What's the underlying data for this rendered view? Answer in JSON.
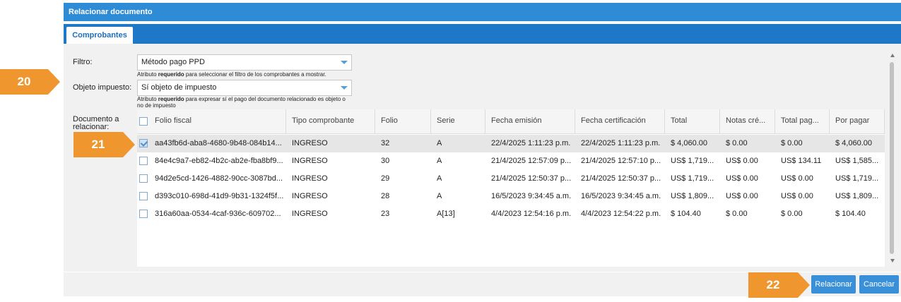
{
  "dialog": {
    "title": "Relacionar documento",
    "tab_label": "Comprobantes"
  },
  "form": {
    "filter_label": "Filtro:",
    "filter_value": "Método pago PPD",
    "filter_hint_pre": "Atributo ",
    "filter_hint_bold": "requerido",
    "filter_hint_post": " para seleccionar el filtro de los comprobantes a mostrar.",
    "tax_label": "Objeto impuesto:",
    "tax_value": "Sí objeto de impuesto",
    "tax_hint_pre": "Atributo ",
    "tax_hint_bold": "requerido",
    "tax_hint_post": " para expresar sí el pago del documento relacionado es objeto o no de impuesto",
    "doc_label_line1": "Documento a",
    "doc_label_line2": "relacionar:"
  },
  "table": {
    "headers": [
      "Folio fiscal",
      "Tipo comprobante",
      "Folio",
      "Serie",
      "Fecha emisión",
      "Fecha certificación",
      "Total",
      "Notas cré...",
      "Total pag...",
      "Por pagar"
    ],
    "rows": [
      {
        "selected": true,
        "cells": [
          "aa43fb6d-aba8-4680-9b48-084b14...",
          "INGRESO",
          "32",
          "A",
          "22/4/2025 1:11:23 p.m.",
          "22/4/2025 1:11:23 p.m.",
          "$ 4,060.00",
          "$ 0.00",
          "$ 0.00",
          "$ 4,060.00"
        ]
      },
      {
        "selected": false,
        "cells": [
          "84e4c9a7-eb82-4b2c-ab2e-fba8bf9...",
          "INGRESO",
          "30",
          "A",
          "21/4/2025 12:57:09 p...",
          "21/4/2025 12:57:10 p...",
          "US$ 1,719...",
          "US$ 0.00",
          "US$ 134.11",
          "US$ 1,585..."
        ]
      },
      {
        "selected": false,
        "cells": [
          "94d2e5cd-1426-4882-90cc-3087bd...",
          "INGRESO",
          "29",
          "A",
          "21/4/2025 12:50:37 p...",
          "21/4/2025 12:50:37 p...",
          "US$ 1,719...",
          "US$ 0.00",
          "US$ 0.00",
          "US$ 1,719..."
        ]
      },
      {
        "selected": false,
        "cells": [
          "d393c010-698d-41d9-9b31-1324f5f...",
          "INGRESO",
          "28",
          "A",
          "16/5/2023 9:34:45 a.m.",
          "16/5/2023 9:34:45 a.m.",
          "US$ 1,809...",
          "US$ 0.00",
          "US$ 0.00",
          "US$ 1,809..."
        ]
      },
      {
        "selected": false,
        "cells": [
          "316a60aa-0534-4caf-936c-609702...",
          "INGRESO",
          "23",
          "A[13]",
          "4/4/2023 12:54:16 p.m.",
          "4/4/2023 12:54:22 p.m.",
          "$ 104.40",
          "$ 0.00",
          "$ 0.00",
          "$ 104.40"
        ]
      }
    ]
  },
  "buttons": {
    "relate": "Relacionar",
    "cancel": "Cancelar"
  },
  "callouts": {
    "c20": "20",
    "c21": "21",
    "c22": "22"
  },
  "colors": {
    "titlebar": "#2e8bd6",
    "tabstrip": "#1f77c8",
    "button": "#3a8fd9",
    "callout": "#f0962e"
  },
  "icons": {
    "dropdown": "caret-down-icon",
    "checkbox": "checkbox-icon",
    "scroll_up": "scroll-up-icon",
    "scroll_down": "scroll-down-icon"
  }
}
